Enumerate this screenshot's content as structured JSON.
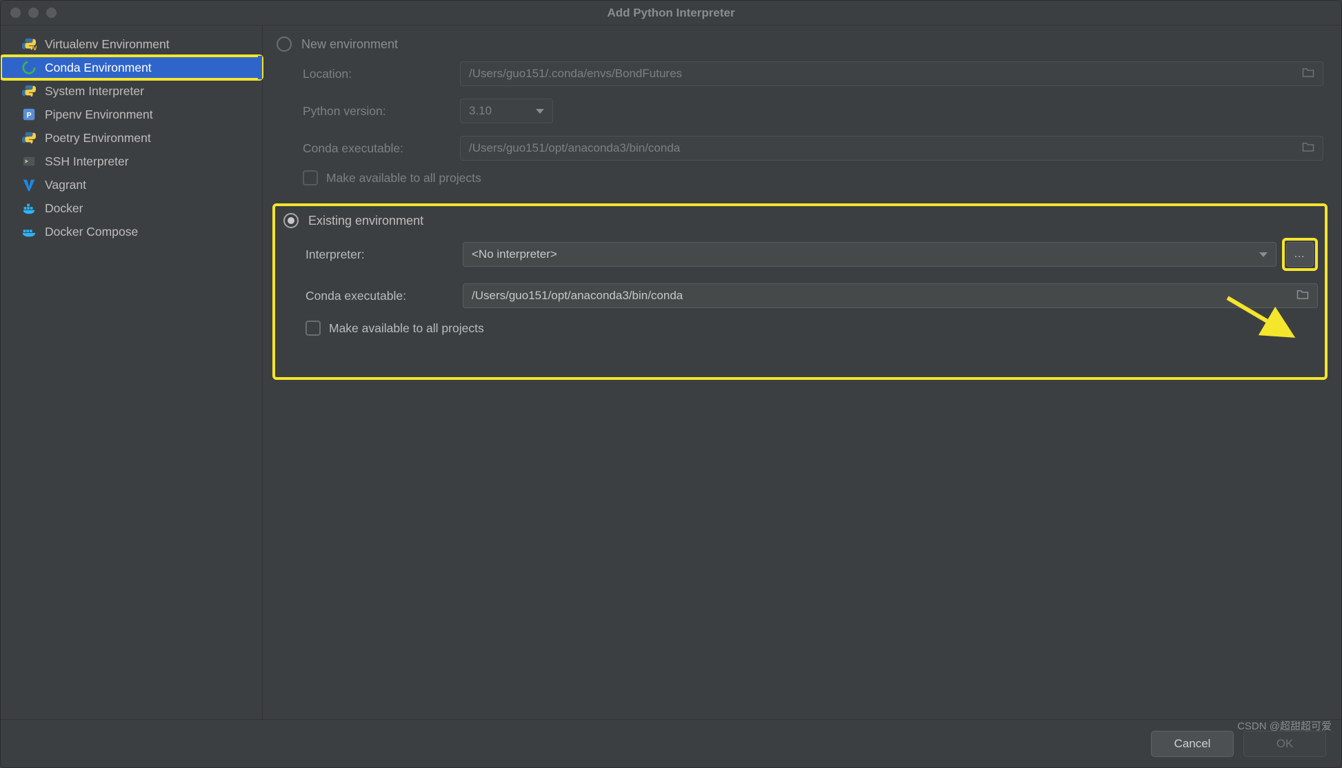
{
  "window": {
    "title": "Add Python Interpreter"
  },
  "sidebar": {
    "items": [
      {
        "label": "Virtualenv Environment",
        "icon": "python-v-icon"
      },
      {
        "label": "Conda Environment",
        "icon": "conda-icon",
        "selected": true
      },
      {
        "label": "System Interpreter",
        "icon": "python-icon"
      },
      {
        "label": "Pipenv Environment",
        "icon": "pipenv-icon"
      },
      {
        "label": "Poetry Environment",
        "icon": "poetry-icon"
      },
      {
        "label": "SSH Interpreter",
        "icon": "ssh-icon"
      },
      {
        "label": "Vagrant",
        "icon": "vagrant-icon"
      },
      {
        "label": "Docker",
        "icon": "docker-icon"
      },
      {
        "label": "Docker Compose",
        "icon": "docker-compose-icon"
      }
    ]
  },
  "new_env": {
    "radio_label": "New environment",
    "location_label": "Location:",
    "location_value": "/Users/guo151/.conda/envs/BondFutures",
    "python_version_label": "Python version:",
    "python_version_value": "3.10",
    "conda_exec_label": "Conda executable:",
    "conda_exec_value": "/Users/guo151/opt/anaconda3/bin/conda",
    "make_available_label": "Make available to all projects"
  },
  "existing_env": {
    "radio_label": "Existing environment",
    "interpreter_label": "Interpreter:",
    "interpreter_value": "<No interpreter>",
    "conda_exec_label": "Conda executable:",
    "conda_exec_value": "/Users/guo151/opt/anaconda3/bin/conda",
    "make_available_label": "Make available to all projects"
  },
  "footer": {
    "cancel": "Cancel",
    "ok": "OK"
  },
  "watermark": "CSDN @超甜超可爱",
  "colors": {
    "bg": "#3c3f41",
    "selection": "#2f65ca",
    "highlight": "#f4e52d"
  }
}
